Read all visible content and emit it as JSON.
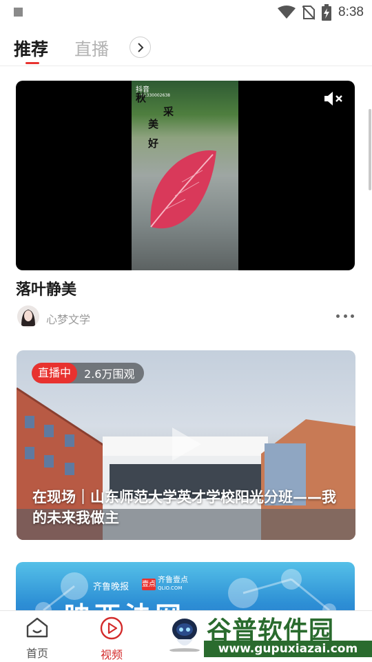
{
  "status_bar": {
    "time": "8:38"
  },
  "tabs": [
    {
      "label": "推荐",
      "active": true
    },
    {
      "label": "直播",
      "active": false
    }
  ],
  "feed": [
    {
      "type": "video",
      "title": "落叶静美",
      "author": "心梦文学",
      "overlay": {
        "app_tag": "抖音",
        "id_text": "01330002638",
        "poem": [
          "秋",
          "美",
          "好",
          "采"
        ]
      }
    },
    {
      "type": "live",
      "badge": "直播中",
      "viewers": "2.6万围观",
      "title": "在现场｜山东师范大学英才学校阳光分班——我的未来我做主"
    },
    {
      "type": "banner",
      "logo_text_1": "齐鲁晚报",
      "logo_box": "壹点",
      "logo_text_2": "齐鲁壹点",
      "logo_sub": "QLIO.COM",
      "big_text": "映西法网"
    }
  ],
  "bottom_nav": [
    {
      "label": "首页",
      "active": false
    },
    {
      "label": "视频",
      "active": true
    }
  ],
  "watermark": {
    "text": "谷普软件园",
    "url": "www.gupuxiazai.com"
  },
  "colors": {
    "accent": "#e8322f",
    "watermark": "#2a6b2e"
  }
}
